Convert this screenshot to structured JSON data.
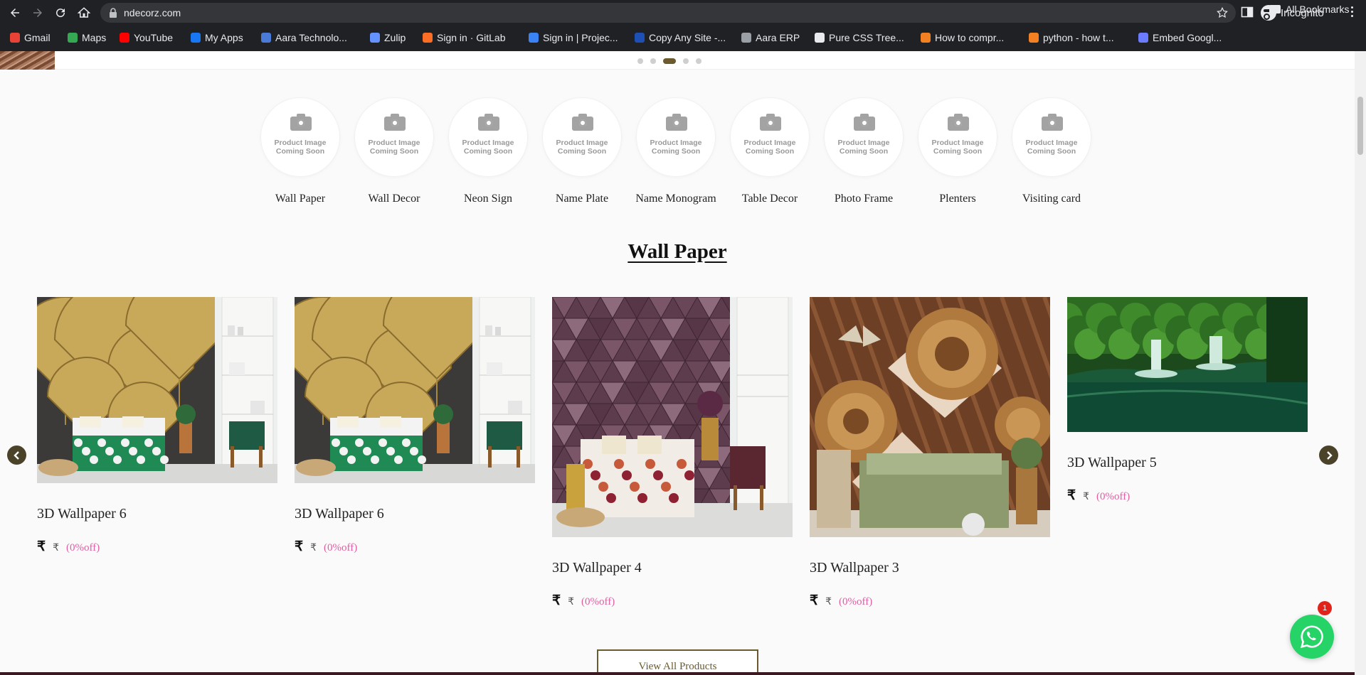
{
  "browser": {
    "url": "ndecorz.com",
    "profile_label": "Incognito",
    "bookmarks": [
      {
        "label": "Gmail",
        "color": "#ea4335"
      },
      {
        "label": "Maps",
        "color": "#34a853"
      },
      {
        "label": "YouTube",
        "color": "#ff0000"
      },
      {
        "label": "My Apps",
        "color": "#1877f2"
      },
      {
        "label": "Aara Technolo...",
        "color": "#4a7bd6"
      },
      {
        "label": "Zulip",
        "color": "#6492fe"
      },
      {
        "label": "Sign in · GitLab",
        "color": "#fc6d26"
      },
      {
        "label": "Sign in | Projec...",
        "color": "#3b82f6"
      },
      {
        "label": "Copy Any Site -...",
        "color": "#1e4fb5"
      },
      {
        "label": "Aara ERP",
        "color": "#9aa0a6"
      },
      {
        "label": "Pure CSS Tree...",
        "color": "#e8eaed"
      },
      {
        "label": "How to compr...",
        "color": "#f48024"
      },
      {
        "label": "python - how t...",
        "color": "#f48024"
      },
      {
        "label": "Embed Googl...",
        "color": "#6b7cff"
      }
    ],
    "more_label": "»",
    "all_bookmarks_label": "All Bookmarks"
  },
  "carousel": {
    "dot_count": 5,
    "active_index": 2
  },
  "categories": {
    "placeholder_line1": "Product Image",
    "placeholder_line2": "Coming Soon",
    "items": [
      {
        "label": "Wall Paper"
      },
      {
        "label": "Wall Decor"
      },
      {
        "label": "Neon Sign"
      },
      {
        "label": "Name Plate"
      },
      {
        "label": "Name Monogram"
      },
      {
        "label": "Table Decor"
      },
      {
        "label": "Photo Frame"
      },
      {
        "label": "Plenters"
      },
      {
        "label": "Visiting card"
      }
    ]
  },
  "section": {
    "title": "Wall Paper"
  },
  "products": [
    {
      "name": "3D Wallpaper 6",
      "currency": "₹",
      "price_glyph": "₹",
      "discount": "(0%off)",
      "image": "ginkgo-bedroom"
    },
    {
      "name": "3D Wallpaper 6",
      "currency": "₹",
      "price_glyph": "₹",
      "discount": "(0%off)",
      "image": "ginkgo-bedroom"
    },
    {
      "name": "3D Wallpaper 4",
      "currency": "₹",
      "price_glyph": "₹",
      "discount": "(0%off)",
      "image": "pink-triangles-bedroom"
    },
    {
      "name": "3D Wallpaper 3",
      "currency": "₹",
      "price_glyph": "₹",
      "discount": "(0%off)",
      "image": "bronze-medallion-bedroom"
    },
    {
      "name": "3D Wallpaper 5",
      "currency": "₹",
      "price_glyph": "₹",
      "discount": "(0%off)",
      "image": "forest-waterfall"
    }
  ],
  "view_all_label": "View All Products",
  "whatsapp": {
    "badge_count": "1"
  },
  "colors": {
    "accent": "#6b5a2e",
    "discount": "#e05ea3",
    "whatsapp": "#25d366"
  }
}
